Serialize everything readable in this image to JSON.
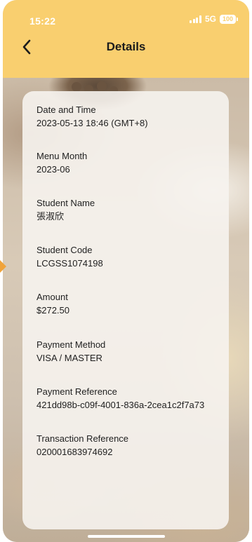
{
  "status_bar": {
    "time": "15:22",
    "network": "5G",
    "battery": "100"
  },
  "header": {
    "title": "Details",
    "back_icon": "chevron-left-icon"
  },
  "colors": {
    "header_bg": "#f9cf6f",
    "accent": "#f0a33a"
  },
  "details": {
    "fields": [
      {
        "label": "Date and Time",
        "value": "2023-05-13 18:46 (GMT+8)"
      },
      {
        "label": "Menu Month",
        "value": "2023-06"
      },
      {
        "label": "Student Name",
        "value": "張淑欣"
      },
      {
        "label": "Student Code",
        "value": "LCGSS1074198"
      },
      {
        "label": "Amount",
        "value": "$272.50"
      },
      {
        "label": "Payment Method",
        "value": "VISA / MASTER"
      },
      {
        "label": "Payment Reference",
        "value": "421dd98b-c09f-4001-836a-2cea1c2f7a73"
      },
      {
        "label": "Transaction Reference",
        "value": "020001683974692"
      }
    ]
  }
}
